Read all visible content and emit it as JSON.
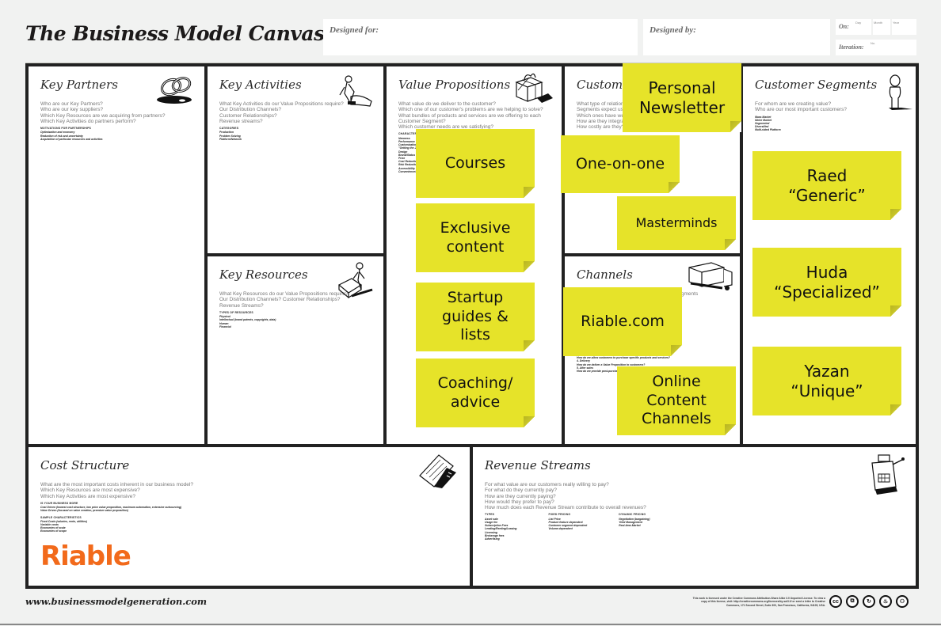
{
  "header": {
    "title": "The Business Model Canvas",
    "designed_for_label": "Designed for:",
    "designed_by_label": "Designed by:",
    "on_label": "On:",
    "on_sublabels": [
      "Day",
      "Month",
      "Year"
    ],
    "iteration_label": "Iteration:",
    "iteration_sublabel": "No."
  },
  "blocks": {
    "key_partners": {
      "title": "Key Partners",
      "questions": "Who are our Key Partners?\nWho are our key suppliers?\nWhich Key Resources are we acquiring from partners?\nWhich Key Activities do partners perform?",
      "hint_heading": "MOTIVATIONS FOR PARTNERSHIPS",
      "hints": "Optimization and economy\nReduction of risk and uncertainty\nAcquisition of particular resources and activities"
    },
    "key_activities": {
      "title": "Key Activities",
      "questions": "What Key Activities do our Value Propositions require?\nOur Distribution Channels?\nCustomer Relationships?\nRevenue streams?",
      "hint_heading": "CATEGORIES",
      "hints": "Production\nProblem Solving\nPlatform/Network"
    },
    "key_resources": {
      "title": "Key Resources",
      "questions": "What Key Resources do our Value Propositions require?\nOur Distribution Channels? Customer Relationships?\nRevenue Streams?",
      "hint_heading": "TYPES OF RESOURCES",
      "hints": "Physical\nIntellectual (brand patents, copyrights, data)\nHuman\nFinancial"
    },
    "value_propositions": {
      "title": "Value Propositions",
      "questions": "What value do we deliver to the customer?\nWhich one of our customer's problems are we helping to solve?\nWhat bundles of products and services are we offering to each Customer Segment?\nWhich customer needs are we satisfying?",
      "hint_heading": "CHARACTERISTICS",
      "hints": "Newness\nPerformance\nCustomization\n\"Getting the Job Done\"\nDesign\nBrand/Status\nPrice\nCost Reduction\nRisk Reduction\nAccessibility\nConvenience/Usability"
    },
    "customer_relationships": {
      "title": "Customer Relationships",
      "questions": "What type of relationship does each of our Customer\nSegments expect us to establish and maintain with them?\nWhich ones have we established?\nHow are they integrated with the rest of our business model?\nHow costly are they?"
    },
    "channels": {
      "title": "Channels",
      "questions": "Through which Channels do our Customer Segments\nwant to be reached?\nHow are we reaching them now?",
      "hints": "3. Purchase\nHow do we allow customers to purchase specific products and services?\n4. Delivery\nHow do we deliver a Value Proposition to customers?\n5. After sales\nHow do we provide post-purchase customer support?"
    },
    "customer_segments": {
      "title": "Customer Segments",
      "questions": "For whom are we creating value?\nWho are our most important customers?",
      "hints": "Mass Market\nNiche Market\nSegmented\nDiversified\nMulti-sided Platform"
    },
    "cost_structure": {
      "title": "Cost Structure",
      "questions": "What are the most important costs inherent in our business model?\nWhich Key Resources are most expensive?\nWhich Key Activities are most expensive?",
      "hint_heading_1": "IS YOUR BUSINESS MORE",
      "hints_1": "Cost Driven (leanest cost structure, low price value proposition, maximum automation, extensive outsourcing)\nValue Driven (focused on value creation, premium value proposition)",
      "hint_heading_2": "SAMPLE CHARACTERISTICS",
      "hints_2": "Fixed Costs (salaries, rents, utilities)\nVariable costs\nEconomies of scale\nEconomies of scope",
      "logo": "Riable"
    },
    "revenue_streams": {
      "title": "Revenue Streams",
      "questions": "For what value are our customers really willing to pay?\nFor what do they currently pay?\nHow are they currently paying?\nHow would they prefer to pay?\nHow much does each Revenue Stream contribute to overall revenues?",
      "col1_heading": "TYPES",
      "col1": "Asset sale\nUsage fee\nSubscription Fees\nLending/Renting/Leasing\nLicensing\nBrokerage fees\nAdvertising",
      "col2_heading": "FIXED PRICING",
      "col2": "List Price\nProduct feature dependent\nCustomer segment dependent\nVolume dependent",
      "col3_heading": "DYNAMIC PRICING",
      "col3": "Negotiation (bargaining)\nYield Management\nReal-time-Market"
    }
  },
  "stickies": {
    "value_propositions": [
      "Courses",
      "Exclusive\ncontent",
      "Startup\nguides &\nlists",
      "Coaching/\nadvice"
    ],
    "customer_relationships": [
      "Personal\nNewsletter",
      "One-on-one",
      "Masterminds"
    ],
    "channels": [
      "Riable.com",
      "Online\nContent\nChannels"
    ],
    "customer_segments": [
      "Raed\n“Generic”",
      "Huda\n“Specialized”",
      "Yazan\n“Unique”"
    ]
  },
  "colors": {
    "sticky": "#e6e329",
    "logo": "#f26a1b",
    "frame": "#222222"
  },
  "footer": {
    "url": "www.businessmodelgeneration.com",
    "license": "This work is licensed under the Creative Commons Attribution-Share Alike 3.0 Unported License. To view a copy of this license, visit: http://creativecommons.org/licenses/by-sa/3.0/ or send a letter to Creative Commons, 171 Second Street, Suite 300, San Francisco, California, 94105, USA.",
    "cc_icons": [
      "cc",
      "⧉",
      "↻",
      "♨",
      "⚇"
    ]
  }
}
